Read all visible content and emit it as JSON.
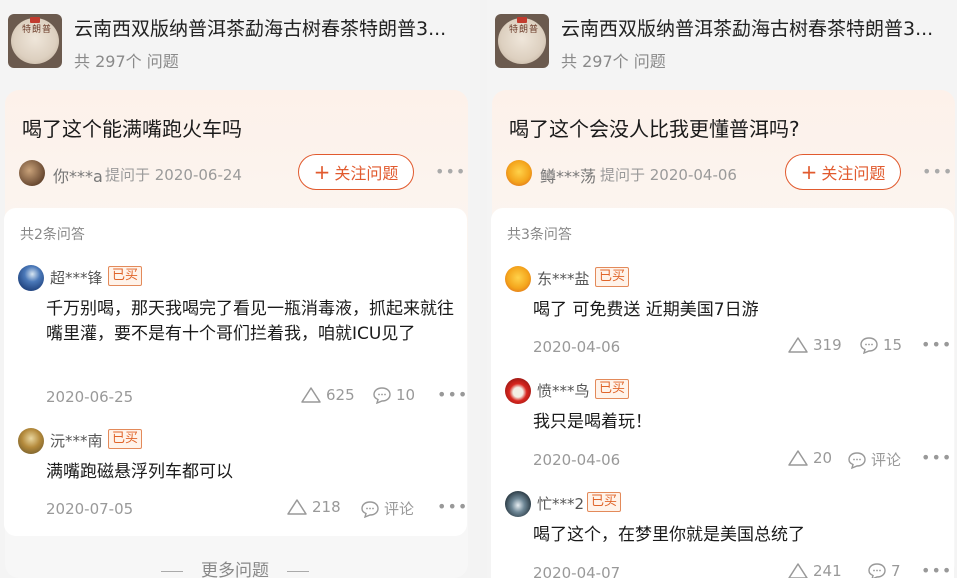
{
  "panels": [
    {
      "product": {
        "title": "云南西双版纳普洱茶勐海古树春茶特朗普3...",
        "count": "共 297个 问题",
        "thumb_text": "特朗普"
      },
      "question": {
        "title": "喝了这个能满嘴跑火车吗",
        "asker": "你***a",
        "asked": "提问于 2020-06-24",
        "follow_plus": "+",
        "follow_label": "关注问题",
        "more": "•••"
      },
      "answers_count": "共2条问答",
      "answers": [
        {
          "name": "超***锋",
          "badge": "已买",
          "text": "千万别喝，那天我喝完了看见一瓶消毒液，抓起来就往嘴里灌，要不是有十个哥们拦着我，咱就ICU见了",
          "date": "2020-06-25",
          "likes": "625",
          "comments": "10",
          "more": "•••"
        },
        {
          "name": "沅***南",
          "badge": "已买",
          "text": "满嘴跑磁悬浮列车都可以",
          "date": "2020-07-05",
          "likes": "218",
          "comments": "评论",
          "more": "•••"
        }
      ],
      "more_questions": "更多问题"
    },
    {
      "product": {
        "title": "云南西双版纳普洱茶勐海古树春茶特朗普3...",
        "count": "共 297个 问题",
        "thumb_text": "特朗普"
      },
      "question": {
        "title": "喝了这个会没人比我更懂普洱吗?",
        "asker": "鳟***荡",
        "asked": "提问于 2020-04-06",
        "follow_plus": "+",
        "follow_label": "关注问题",
        "more": "•••"
      },
      "answers_count": "共3条问答",
      "answers": [
        {
          "name": "东***盐",
          "badge": "已买",
          "text": "喝了 可免费送 近期美国7日游",
          "date": "2020-04-06",
          "likes": "319",
          "comments": "15",
          "more": "•••"
        },
        {
          "name": "愤***鸟",
          "badge": "已买",
          "text": "我只是喝着玩！",
          "date": "2020-04-06",
          "likes": "20",
          "comments": "评论",
          "more": "•••"
        },
        {
          "name": "忙***2",
          "badge": "已买",
          "text": "喝了这个，在梦里你就是美国总统了",
          "date": "2020-04-07",
          "likes": "241",
          "comments": "7",
          "more": "•••"
        }
      ]
    }
  ],
  "colors": {
    "accent": "#e15a2e",
    "badge_text": "#e0652a",
    "muted": "#999999"
  }
}
